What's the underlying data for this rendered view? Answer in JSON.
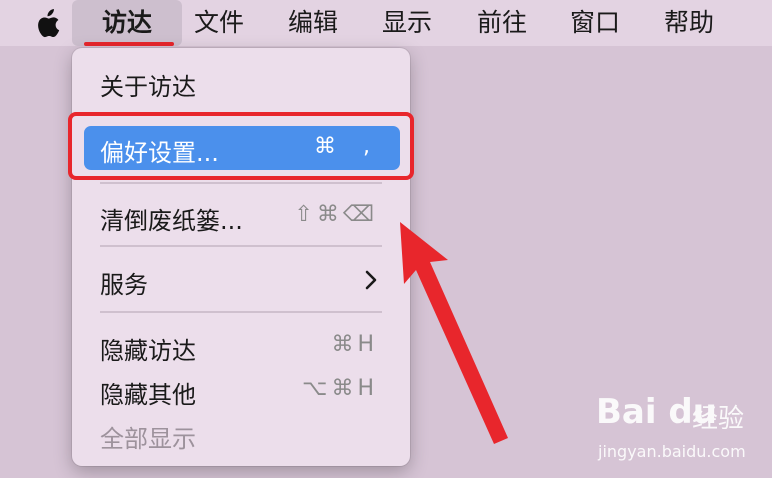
{
  "menubar": {
    "apple_icon": "apple-logo-icon",
    "items": [
      {
        "label": "访达",
        "active": true
      },
      {
        "label": "文件"
      },
      {
        "label": "编辑"
      },
      {
        "label": "显示"
      },
      {
        "label": "前往"
      },
      {
        "label": "窗口"
      },
      {
        "label": "帮助"
      }
    ]
  },
  "dropdown": {
    "items": [
      {
        "label": "关于访达",
        "shortcut": ""
      },
      {
        "label": "偏好设置...",
        "shortcut": "⌘ ,",
        "highlighted": true
      },
      {
        "label": "清倒废纸篓...",
        "shortcut": "⇧⌘⌫"
      },
      {
        "label": "服务",
        "submenu_icon": "chevron-right-icon"
      },
      {
        "label": "隐藏访达",
        "shortcut": "⌘H"
      },
      {
        "label": "隐藏其他",
        "shortcut": "⌥⌘H"
      },
      {
        "label": "全部显示",
        "shortcut": "",
        "disabled": true
      }
    ]
  },
  "colors": {
    "highlight": "#4b90ec",
    "annotation_red": "#e8262c",
    "background": "#d6c4d5"
  },
  "watermark": {
    "brand": "Bai du",
    "sub": "经验",
    "url": "jingyan.baidu.com"
  }
}
